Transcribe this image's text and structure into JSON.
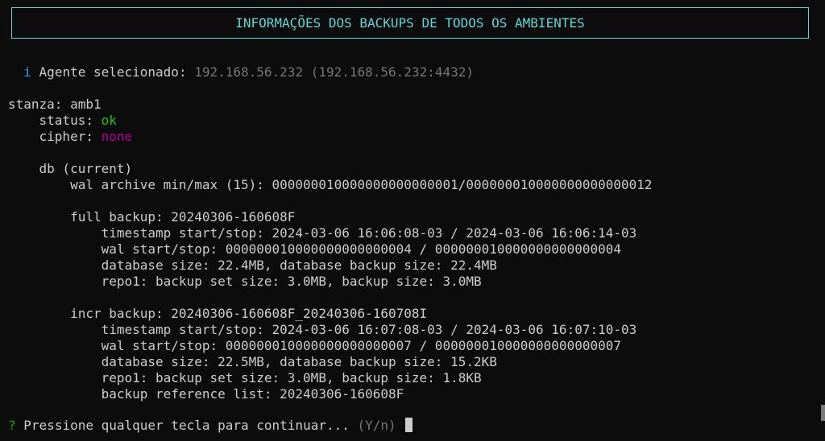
{
  "header": {
    "title": "INFORMAÇÕES DOS BACKUPS DE TODOS OS AMBIENTES"
  },
  "agent": {
    "icon": "i",
    "label": "Agente selecionado:",
    "value": "192.168.56.232 (192.168.56.232:4432)"
  },
  "stanza": {
    "label": "stanza: amb1",
    "status_label": "status:",
    "status_value": "ok",
    "cipher_label": "cipher:",
    "cipher_value": "none",
    "db_label": "db (current)",
    "wal_archive": "wal archive min/max (15): 000000010000000000000001/000000010000000000000012"
  },
  "backups": [
    {
      "title": "full backup: 20240306-160608F",
      "timestamp": "timestamp start/stop: 2024-03-06 16:06:08-03 / 2024-03-06 16:06:14-03",
      "wal": "wal start/stop: 000000010000000000000004 / 000000010000000000000004",
      "db_size": "database size: 22.4MB, database backup size: 22.4MB",
      "repo": "repo1: backup set size: 3.0MB, backup size: 3.0MB"
    },
    {
      "title": "incr backup: 20240306-160608F_20240306-160708I",
      "timestamp": "timestamp start/stop: 2024-03-06 16:07:08-03 / 2024-03-06 16:07:10-03",
      "wal": "wal start/stop: 000000010000000000000007 / 000000010000000000000007",
      "db_size": "database size: 22.5MB, database backup size: 15.2KB",
      "repo": "repo1: backup set size: 3.0MB, backup size: 1.8KB",
      "reference": "backup reference list: 20240306-160608F"
    }
  ],
  "prompt": {
    "qmark": "?",
    "text": "Pressione qualquer tecla para continuar...",
    "hint": "(Y/n)"
  },
  "colors": {
    "background": "#0c0c0c",
    "text": "#cccccc",
    "header": "#61d6d6",
    "ok": "#16c60c",
    "none": "#b4009e",
    "muted": "#767676"
  }
}
